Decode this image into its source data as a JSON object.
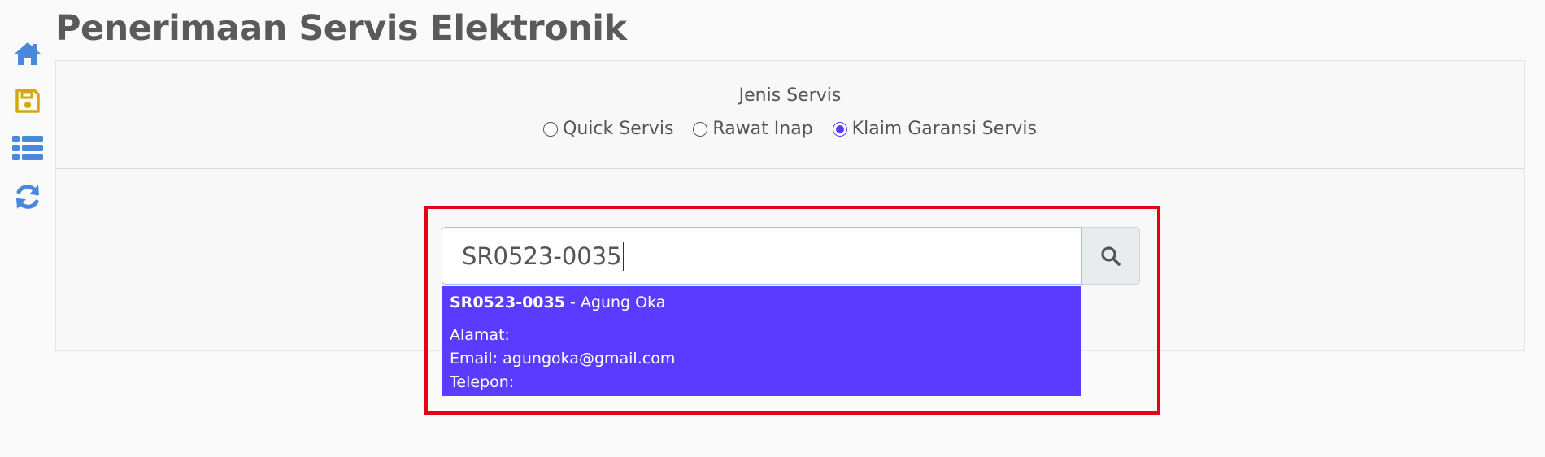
{
  "colors": {
    "accent": "#5b3bff",
    "highlight": "#e6001a",
    "icon_blue": "#4a88dc",
    "icon_gold": "#d4a80e"
  },
  "sidebar": {
    "items": [
      {
        "name": "home-icon"
      },
      {
        "name": "save-icon"
      },
      {
        "name": "list-icon"
      },
      {
        "name": "refresh-icon"
      }
    ]
  },
  "page": {
    "title": "Penerimaan Servis Elektronik"
  },
  "service_type": {
    "label": "Jenis Servis",
    "options": [
      {
        "label": "Quick Servis",
        "selected": false
      },
      {
        "label": "Rawat Inap",
        "selected": false
      },
      {
        "label": "Klaim Garansi Servis",
        "selected": true
      }
    ]
  },
  "search": {
    "value": "SR0523-0035",
    "icon": "search-icon"
  },
  "suggestion": {
    "code": "SR0523-0035",
    "separator": " - ",
    "name": "Agung Oka",
    "alamat": "Alamat:",
    "email": "Email: agungoka@gmail.com",
    "telepon": "Telepon:"
  }
}
